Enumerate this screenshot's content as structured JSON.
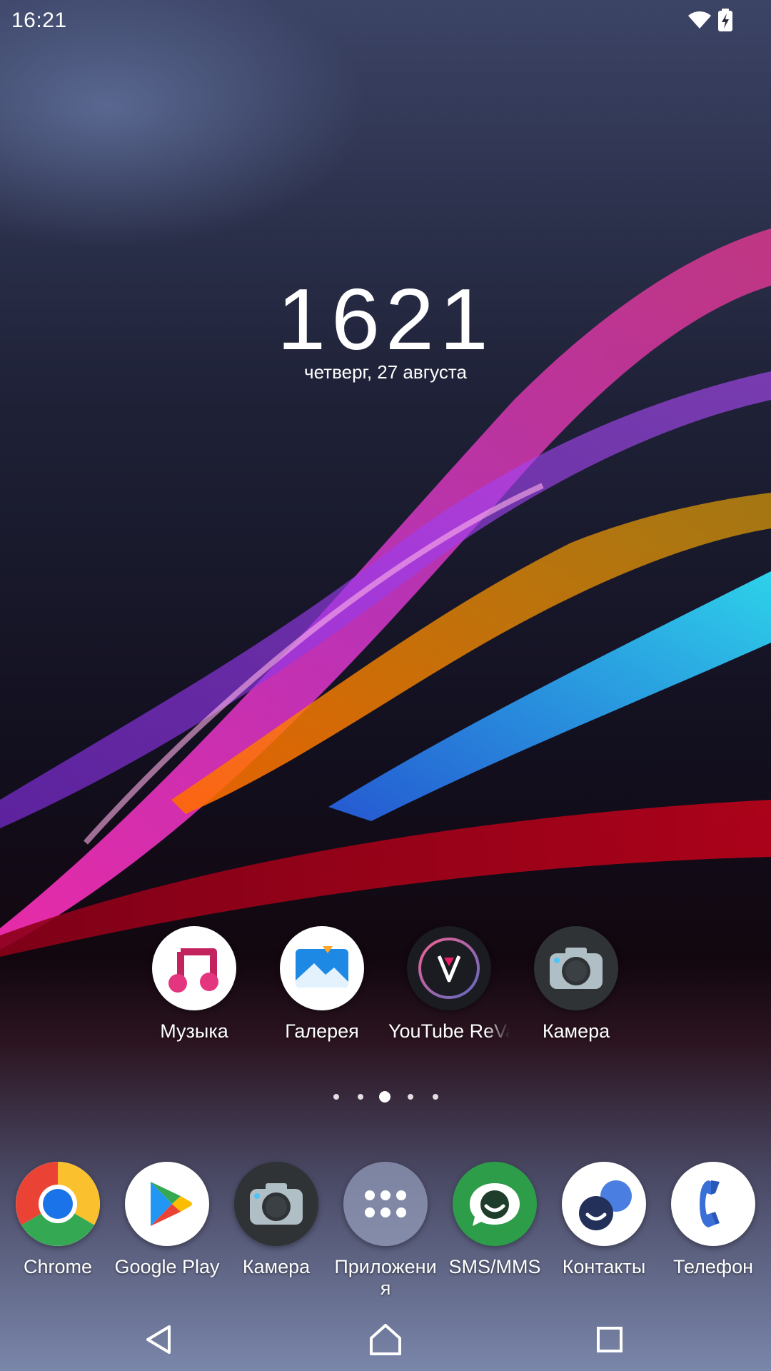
{
  "status_bar": {
    "time": "16:21",
    "wifi_icon": "wifi-icon",
    "battery_icon": "battery-charging-icon"
  },
  "clock_widget": {
    "time": "1621",
    "date": "четверг, 27 августа"
  },
  "home_apps": [
    {
      "label": "Музыка",
      "icon": "music-icon"
    },
    {
      "label": "Галерея",
      "icon": "gallery-icon"
    },
    {
      "label": "YouTube ReVa",
      "icon": "youtube-revanced-icon"
    },
    {
      "label": "Камера",
      "icon": "camera-icon"
    }
  ],
  "page_indicator": {
    "pages": 5,
    "current": 3
  },
  "dock_apps": [
    {
      "label": "Chrome",
      "icon": "chrome-icon"
    },
    {
      "label": "Google Play",
      "icon": "google-play-icon"
    },
    {
      "label": "Камера",
      "icon": "camera-icon"
    },
    {
      "label": "Приложения",
      "icon": "app-drawer-icon"
    },
    {
      "label": "SMS/MMS",
      "icon": "sms-icon"
    },
    {
      "label": "Контакты",
      "icon": "contacts-icon"
    },
    {
      "label": "Телефон",
      "icon": "phone-icon"
    }
  ],
  "nav_bar": {
    "back": "back-icon",
    "home": "home-icon",
    "recents": "recents-icon"
  },
  "colors": {
    "music_pink": "#e4357f",
    "gallery_blue": "#1e88e5",
    "chrome_blue": "#1a73e8",
    "sms_green": "#2e9d4a",
    "contacts_navy": "#22305a",
    "phone_blue": "#3b6fd8"
  }
}
